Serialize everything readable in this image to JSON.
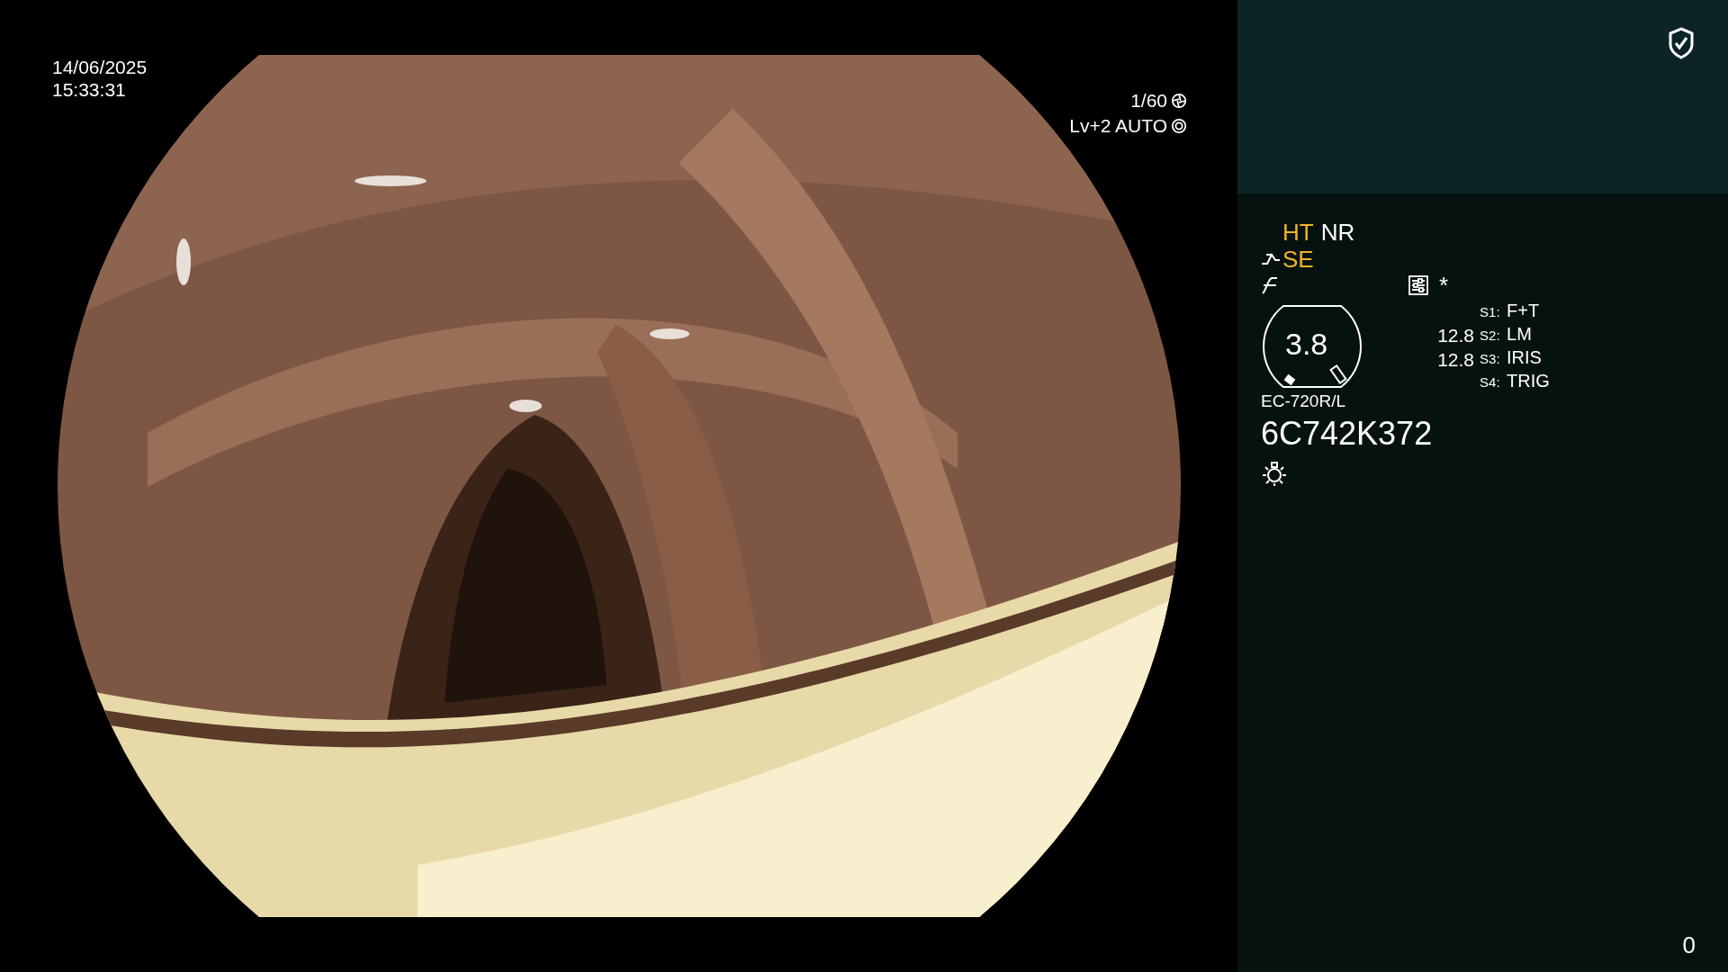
{
  "timestamp": {
    "date": "14/06/2025",
    "time": "15:33:31"
  },
  "camera_overlay": {
    "shutter": "1/60",
    "exposure": "Lv+2 AUTO"
  },
  "status_panel": {
    "image_modes": [
      {
        "label": "HT",
        "active": true
      },
      {
        "label": "NR",
        "active": false
      }
    ],
    "enhancement": {
      "label": "SE",
      "active": true
    },
    "asterisk": "*",
    "gauge_value": "3.8",
    "readings": [
      "12.8",
      "12.8"
    ],
    "switches": [
      {
        "key": "S1:",
        "value": "F+T"
      },
      {
        "key": "S2:",
        "value": "LM"
      },
      {
        "key": "S3:",
        "value": "IRIS"
      },
      {
        "key": "S4:",
        "value": "TRIG"
      }
    ],
    "scope_model": "EC-720R/L",
    "serial": "6C742K372"
  },
  "counter": "0"
}
